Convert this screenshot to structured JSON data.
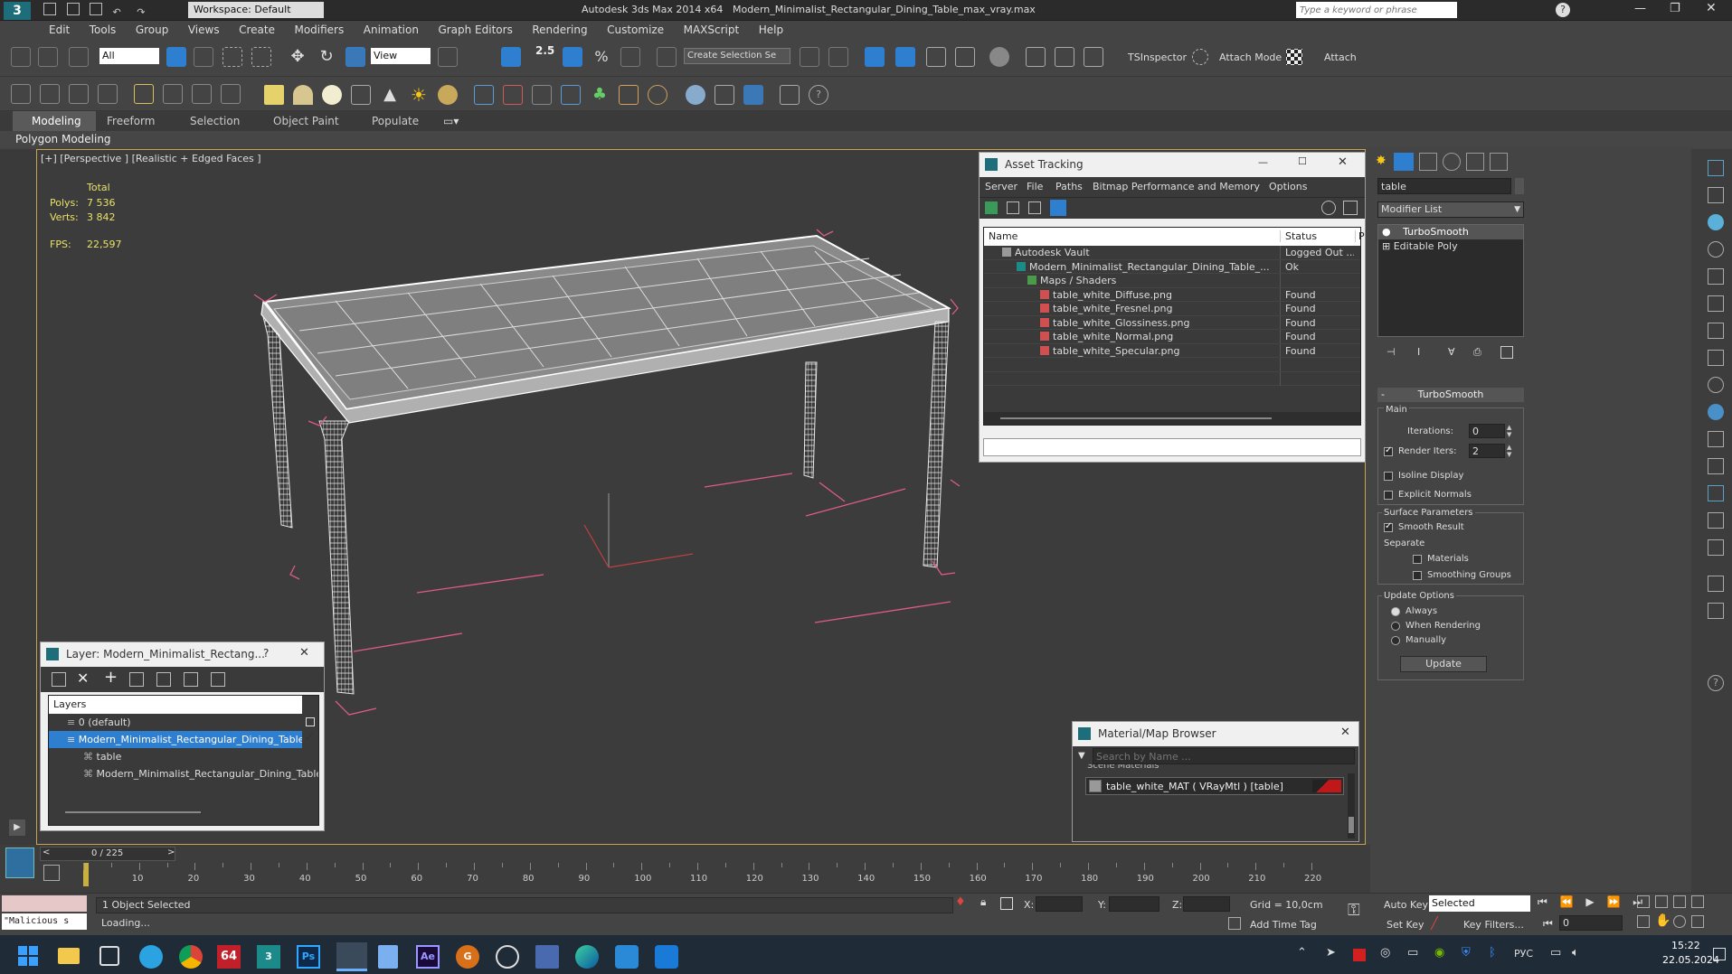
{
  "window": {
    "app_title": "Autodesk 3ds Max  2014 x64",
    "file_title": "Modern_Minimalist_Rectangular_Dining_Table_max_vray.max",
    "workspace": "Workspace: Default",
    "search_placeholder": "Type a keyword or phrase"
  },
  "menu": [
    "Edit",
    "Tools",
    "Group",
    "Views",
    "Create",
    "Modifiers",
    "Animation",
    "Graph Editors",
    "Rendering",
    "Customize",
    "MAXScript",
    "Help"
  ],
  "toolbar": {
    "filter": "All",
    "view": "View",
    "snap_value": "2.5",
    "selection_set": "Create Selection Se",
    "ts_inspector": "TSInspector",
    "attach_mode": "Attach Mode",
    "attach": "Attach"
  },
  "ribbon": {
    "tabs": [
      "Modeling",
      "Freeform",
      "Selection",
      "Object Paint",
      "Populate"
    ],
    "sub": "Polygon Modeling"
  },
  "viewport": {
    "label": "[+] [Perspective ] [Realistic + Edged Faces ]",
    "stats_header": "Total",
    "polys_label": "Polys:",
    "polys_value": "7 536",
    "verts_label": "Verts:",
    "verts_value": "3 842",
    "fps_label": "FPS:",
    "fps_value": "22,597"
  },
  "asset_tracking": {
    "title": "Asset Tracking",
    "menu": [
      "Server",
      "File",
      "Paths",
      "Bitmap Performance and Memory",
      "Options"
    ],
    "col_name": "Name",
    "col_status": "Status",
    "col_p": "P",
    "rows": [
      {
        "name": "Autodesk Vault",
        "status": "Logged Out ..."
      },
      {
        "name": "Modern_Minimalist_Rectangular_Dining_Table_...",
        "status": "Ok"
      },
      {
        "name": "Maps / Shaders",
        "status": ""
      },
      {
        "name": "table_white_Diffuse.png",
        "status": "Found"
      },
      {
        "name": "table_white_Fresnel.png",
        "status": "Found"
      },
      {
        "name": "table_white_Glossiness.png",
        "status": "Found"
      },
      {
        "name": "table_white_Normal.png",
        "status": "Found"
      },
      {
        "name": "table_white_Specular.png",
        "status": "Found"
      }
    ]
  },
  "layer_window": {
    "title": "Layer: Modern_Minimalist_Rectang...",
    "help": "?",
    "header": "Layers",
    "items": [
      "0 (default)",
      "Modern_Minimalist_Rectangular_Dining_Table",
      "table",
      "Modern_Minimalist_Rectangular_Dining_Table"
    ]
  },
  "material_browser": {
    "title": "Material/Map Browser",
    "search": "Search by Name ...",
    "section": "Scene Materials",
    "item": "table_white_MAT  ( VRayMtl )  [table]"
  },
  "command_panel": {
    "object_name": "table",
    "modifier_list": "Modifier List",
    "stack": [
      "TurboSmooth",
      "Editable Poly"
    ],
    "rollout_title": "TurboSmooth",
    "main": "Main",
    "iterations_label": "Iterations:",
    "iterations_value": "0",
    "render_iters_label": "Render Iters:",
    "render_iters_value": "2",
    "isoline": "Isoline Display",
    "explicit_normals": "Explicit Normals",
    "surface_params": "Surface Parameters",
    "smooth_result": "Smooth Result",
    "separate": "Separate",
    "materials": "Materials",
    "smoothing_groups": "Smoothing Groups",
    "update_options": "Update Options",
    "always": "Always",
    "when_rendering": "When Rendering",
    "manually": "Manually",
    "update_button": "Update"
  },
  "timeline": {
    "frame": "0 / 225",
    "ticks": [
      "10",
      "20",
      "30",
      "40",
      "50",
      "60",
      "70",
      "80",
      "90",
      "100",
      "110",
      "120",
      "130",
      "140",
      "150",
      "160",
      "170",
      "180",
      "190",
      "200",
      "210",
      "220"
    ]
  },
  "status": {
    "script": "\"Malicious s",
    "selected": "1 Object Selected",
    "loading": "Loading...",
    "x_label": "X:",
    "y_label": "Y:",
    "z_label": "Z:",
    "grid": "Grid = 10,0cm",
    "add_time_tag": "Add Time Tag",
    "auto_key": "Auto Key",
    "selected_dd": "Selected",
    "set_key": "Set Key",
    "key_filters": "Key Filters...",
    "frame_value": "0"
  },
  "taskbar": {
    "badge": "64",
    "lang": "РУС",
    "time": "15:22",
    "date": "22.05.2024"
  }
}
